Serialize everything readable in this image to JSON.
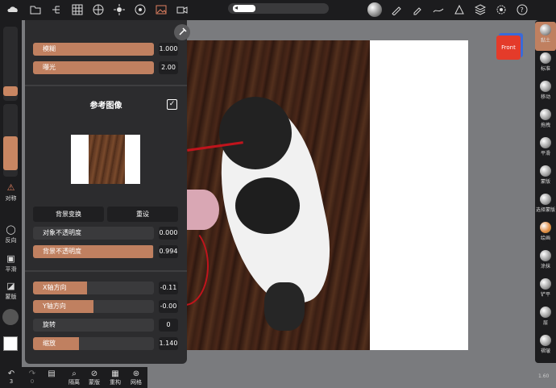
{
  "topbar": {
    "left_icons": [
      "cloud-icon",
      "folder-icon",
      "hierarchy-icon",
      "grid-icon",
      "globe-icon",
      "sun-icon",
      "material-icon",
      "image-icon",
      "video-icon"
    ],
    "right_icons": [
      "sphere-icon",
      "brush-icon",
      "picker-icon",
      "stroke-icon",
      "symmetry-icon",
      "layers-icon",
      "settings-icon",
      "help-icon"
    ]
  },
  "panel": {
    "sliders_top": [
      {
        "label": "模糊",
        "value": "1.000",
        "fill": 1.0
      },
      {
        "label": "曝光",
        "value": "2.00",
        "fill": 1.0
      }
    ],
    "ref_title": "参考图像",
    "check": "✓",
    "buttons": {
      "bg_swap": "背景变换",
      "reset": "重设"
    },
    "opacity": [
      {
        "label": "对象不透明度",
        "value": "0.000",
        "fill": 0.0
      },
      {
        "label": "背景不透明度",
        "value": "0.994",
        "fill": 0.994
      }
    ],
    "transform": [
      {
        "label": "X轴方向",
        "value": "-0.11",
        "fill": 0.45
      },
      {
        "label": "Y轴方向",
        "value": "-0.00",
        "fill": 0.5
      },
      {
        "label": "旋转",
        "value": "0",
        "fill": 0.0
      },
      {
        "label": "缩放",
        "value": "1.140",
        "fill": 0.38
      }
    ]
  },
  "left_sidebar": {
    "symmetry": "对称",
    "invert": "反向",
    "smooth": "平滑",
    "mask": "蒙版"
  },
  "right_sidebar": {
    "tools": [
      "黏土",
      "标准",
      "移动",
      "拖拽",
      "平滑",
      "蒙版",
      "选择蒙版",
      "绘画",
      "涂抹",
      "铲平",
      "层",
      "褶皱"
    ],
    "active": 0
  },
  "cube": {
    "label": "Front"
  },
  "bottom": {
    "undo_count": "3",
    "redo_count": "0",
    "items": [
      "隔离",
      "蒙版",
      "重构",
      "网格"
    ]
  },
  "version": "1.60"
}
